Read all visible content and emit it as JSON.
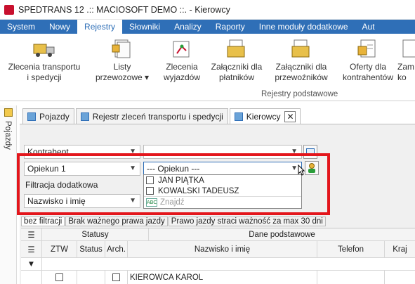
{
  "window": {
    "title": "SPEDTRANS 12 .:: MACIOSOFT DEMO ::. - Kierowcy"
  },
  "menu": {
    "items": [
      "System",
      "Nowy",
      "Rejestry",
      "Słowniki",
      "Analizy",
      "Raporty",
      "Inne moduły dodatkowe",
      "Aut"
    ],
    "active": "Rejestry"
  },
  "ribbon": {
    "buttons": [
      {
        "line1": "Zlecenia transportu",
        "line2": "i spedycji",
        "icon": "truck-icon"
      },
      {
        "line1": "Listy",
        "line2": "przewozowe ▾",
        "icon": "documents-icon"
      },
      {
        "line1": "Zlecenia",
        "line2": "wyjazdów",
        "icon": "ztw-icon"
      },
      {
        "line1": "Załączniki dla",
        "line2": "płatników",
        "icon": "attachment-folder-icon"
      },
      {
        "line1": "Załączniki dla",
        "line2": "przewoźników",
        "icon": "attachment-folder-icon"
      },
      {
        "line1": "Oferty dla",
        "line2": "kontrahentów",
        "icon": "offer-icon"
      },
      {
        "line1": "Zam",
        "line2": "ko",
        "icon": "order-icon"
      }
    ],
    "group_label": "Rejestry podstawowe"
  },
  "side_panel": {
    "label": "Pojazdy"
  },
  "doc_tabs": [
    {
      "label": "Pojazdy",
      "active": false
    },
    {
      "label": "Rejestr zleceń transportu i spedycji",
      "active": false
    },
    {
      "label": "Kierowcy",
      "active": true
    }
  ],
  "filters": {
    "row1": {
      "field": "Kontrahent",
      "value": ""
    },
    "row2": {
      "field": "Opiekun 1",
      "value": "--- Opiekun ---"
    },
    "extra_label": "Filtracja dodatkowa",
    "row3": {
      "field": "Nazwisko i imię"
    }
  },
  "dropdown": {
    "options": [
      "JAN PIĄTKA",
      "KOWALSKI TADEUSZ"
    ],
    "search_placeholder": "Znajdź",
    "search_icon_text": "ABC"
  },
  "filter_tabs": [
    "bez filtracji",
    "Brak ważnego prawa jazdy",
    "Prawo jazdy straci ważność za max 30 dni"
  ],
  "grid": {
    "group_headers": {
      "statusy": "Statusy",
      "dane": "Dane podstawowe"
    },
    "columns": {
      "ztw": "ZTW",
      "status": "Status",
      "arch": "Arch.",
      "name": "Nazwisko i imię",
      "phone": "Telefon",
      "country": "Kraj"
    },
    "rows": [
      {
        "name": "KIEROWCA KAROL"
      }
    ]
  },
  "colors": {
    "menubar": "#2f6fb7",
    "highlight": "#e3161c"
  }
}
